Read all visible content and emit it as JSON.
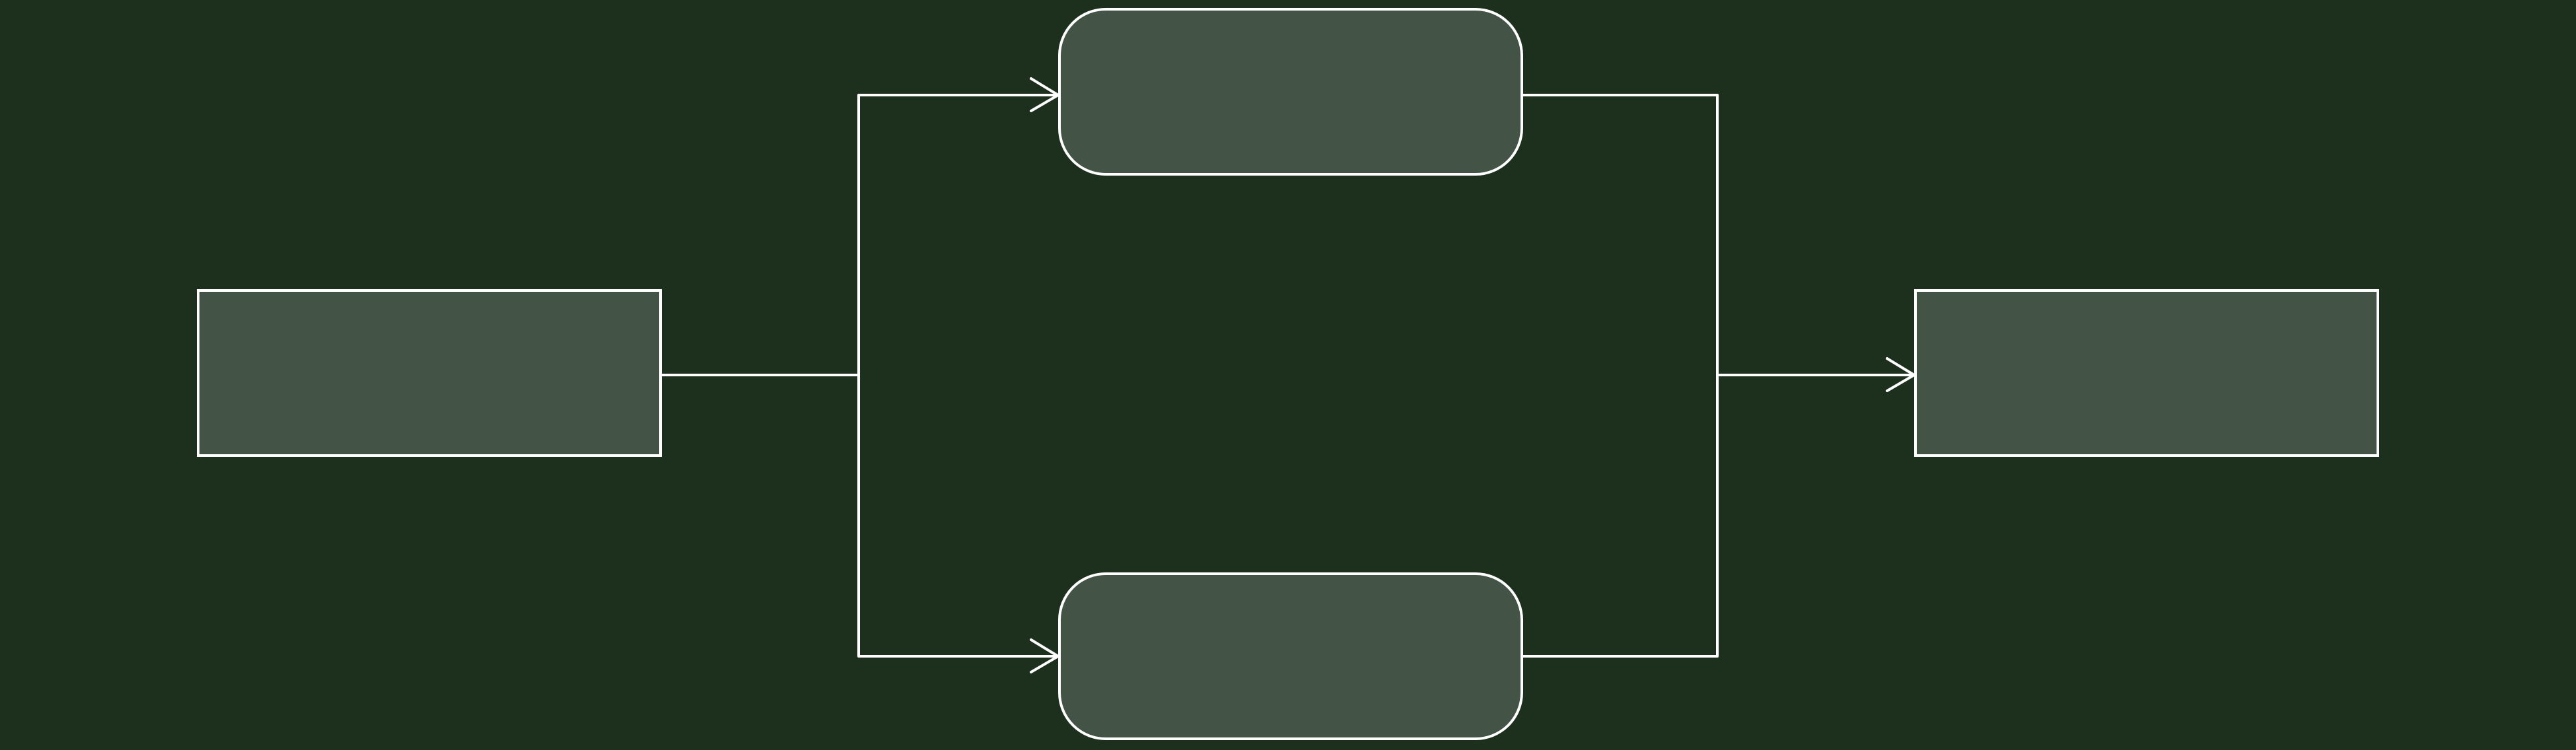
{
  "colors": {
    "background": "#1d301d",
    "node_fill": "#435346",
    "stroke": "#ffffff",
    "text": "#ffffff"
  },
  "nodes": {
    "source": {
      "label": "",
      "shape": "rectangle"
    },
    "branch_top": {
      "label": "",
      "shape": "rounded-rectangle"
    },
    "branch_bottom": {
      "label": "",
      "shape": "rounded-rectangle"
    },
    "target": {
      "label": "",
      "shape": "rectangle"
    }
  },
  "edges": [
    {
      "from": "source",
      "to": "branch_top",
      "arrow": "end"
    },
    {
      "from": "source",
      "to": "branch_bottom",
      "arrow": "end"
    },
    {
      "from": "branch_top",
      "to": "target",
      "arrow": "end"
    },
    {
      "from": "branch_bottom",
      "to": "target",
      "arrow": "end"
    }
  ]
}
